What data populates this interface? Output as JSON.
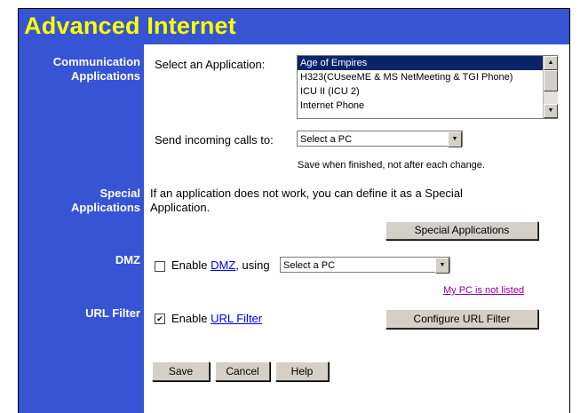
{
  "page": {
    "title": "Advanced Internet"
  },
  "sidebar": {
    "communication_line1": "Communication",
    "communication_line2": "Applications",
    "special_line1": "Special",
    "special_line2": "Applications",
    "dmz": "DMZ",
    "url_filter": "URL Filter"
  },
  "communication": {
    "select_label": "Select an Application:",
    "applications": [
      "Age of Empires",
      "H323(CUseeME & MS NetMeeting & TGI Phone)",
      "ICU II (ICU 2)",
      "Internet Phone"
    ],
    "selected_application": "Age of Empires",
    "send_calls_label": "Send incoming calls to:",
    "send_calls_value": "Select a PC",
    "save_note": "Save when finished, not after each change."
  },
  "special": {
    "desc_line1": "If an application does not work, you can define it as a Special",
    "desc_line2": "Application.",
    "button": "Special Applications"
  },
  "dmz": {
    "enable_prefix": "Enable ",
    "link": "DMZ",
    "using": ", using",
    "select_value": "Select a PC",
    "checked": false,
    "not_listed_link": "My PC is not listed"
  },
  "url_filter": {
    "enable_prefix": "Enable ",
    "link": "URL Filter",
    "checked": true,
    "configure_button": "Configure URL Filter"
  },
  "actions": {
    "save": "Save",
    "cancel": "Cancel",
    "help": "Help"
  }
}
